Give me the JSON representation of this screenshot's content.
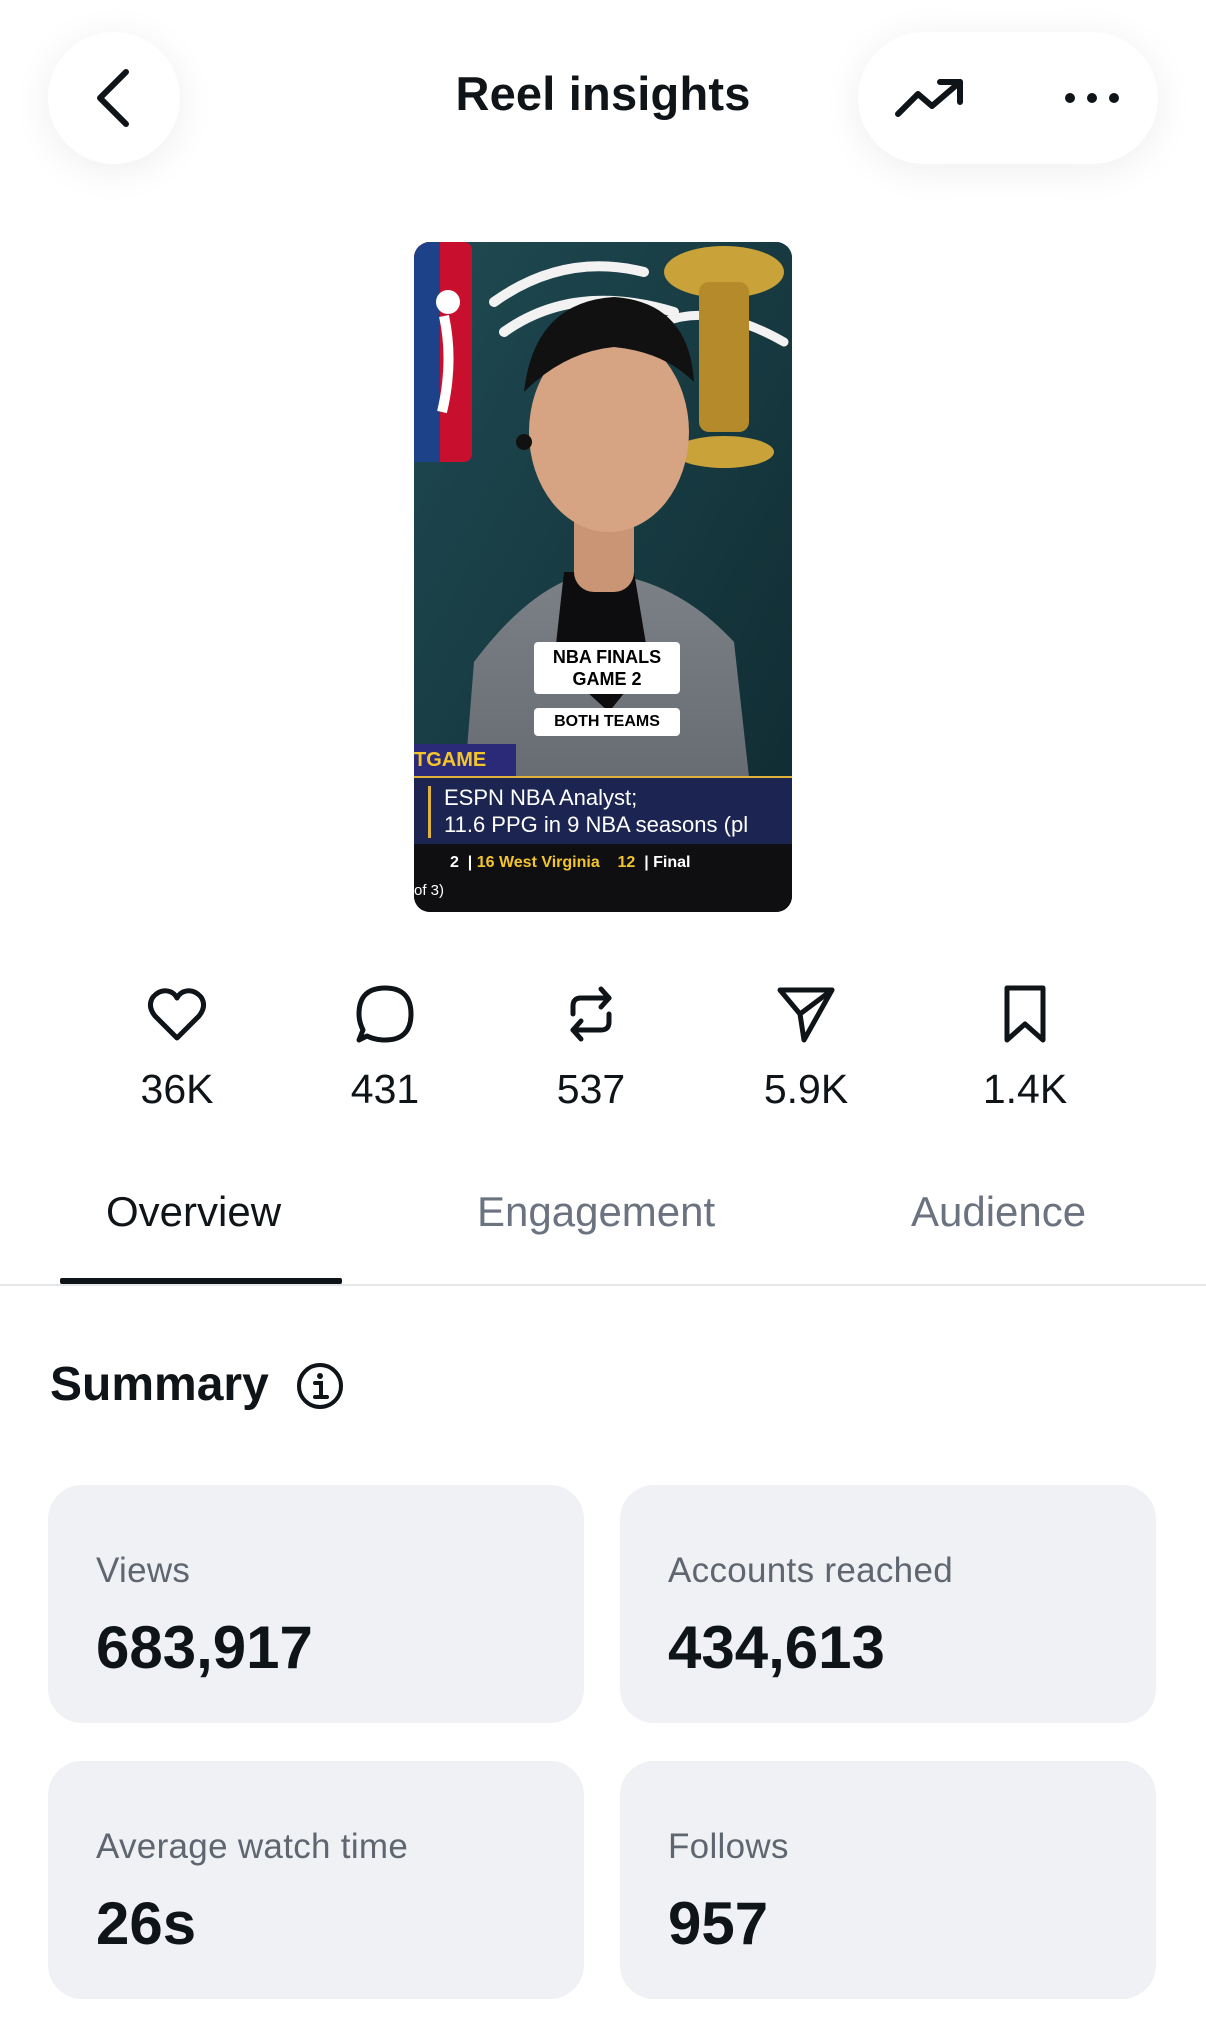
{
  "header": {
    "title": "Reel insights",
    "back_icon": "chevron-left-icon",
    "trend_icon": "trending-up-icon",
    "more_icon": "more-horizontal-icon"
  },
  "thumbnail": {
    "badge_line1": "NBA FINALS",
    "badge_line2": "GAME 2",
    "badge_line3": "BOTH TEAMS",
    "ticker_tag": "TGAME",
    "lower_line1": "ESPN NBA Analyst;",
    "lower_line2": "11.6 PPG in 9 NBA seasons (pl",
    "score_a": "2",
    "score_team": "16 West Virginia",
    "score_b": "12",
    "score_status": "Final",
    "score_note": "of 3)"
  },
  "stats": [
    {
      "icon": "heart-icon",
      "value": "36K"
    },
    {
      "icon": "comment-icon",
      "value": "431"
    },
    {
      "icon": "repost-icon",
      "value": "537"
    },
    {
      "icon": "share-icon",
      "value": "5.9K"
    },
    {
      "icon": "bookmark-icon",
      "value": "1.4K"
    }
  ],
  "tabs": {
    "overview": "Overview",
    "engagement": "Engagement",
    "audience": "Audience",
    "active": "Overview"
  },
  "summary": {
    "title": "Summary",
    "info_icon": "info-icon",
    "cards": [
      {
        "label": "Views",
        "value": "683,917"
      },
      {
        "label": "Accounts reached",
        "value": "434,613"
      },
      {
        "label": "Average watch time",
        "value": "26s"
      },
      {
        "label": "Follows",
        "value": "957"
      }
    ]
  },
  "colors": {
    "text_primary": "#0f1419",
    "text_secondary": "#6b7280",
    "card_bg": "#eff1f5"
  }
}
